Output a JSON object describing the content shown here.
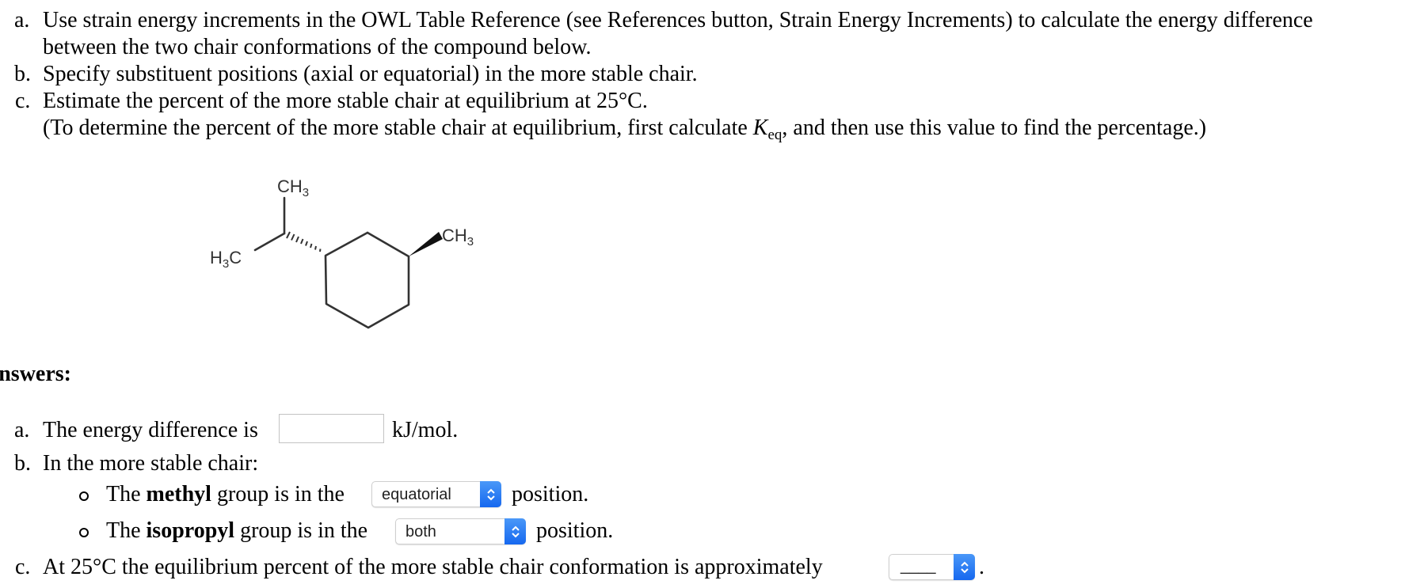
{
  "question": {
    "items": [
      {
        "marker": "a.",
        "lines": [
          "Use strain energy increments in the OWL Table Reference (see References button, Strain Energy Increments) to calculate the energy difference",
          "between the two chair conformations of the compound below."
        ]
      },
      {
        "marker": "b.",
        "lines": [
          "Specify substituent positions (axial or equatorial) in the more stable chair."
        ]
      },
      {
        "marker": "c.",
        "lines": [
          "Estimate the percent of the more stable chair at equilibrium at 25°C."
        ]
      }
    ],
    "note_prefix": "(To determine the percent of the more stable chair at equilibrium, first calculate ",
    "note_k": "K",
    "note_k_sub": "eq",
    "note_suffix": ", and then use this value to find the percentage.)"
  },
  "molecule": {
    "name": "isopropyl-methylcyclohexane structure",
    "labels": {
      "isopropyl_top_methyl": "CH3",
      "isopropyl_left_methyl": "H3C",
      "ring_methyl": "CH3"
    }
  },
  "answers": {
    "heading": "Answers:",
    "a": {
      "marker": "a.",
      "prefix": "The energy difference is",
      "input_value": "",
      "unit": "kJ/mol."
    },
    "b": {
      "marker": "b.",
      "label": "In the more stable chair:",
      "rows": [
        {
          "prefix": "The ",
          "bold": "methyl",
          "middle": " group is in the",
          "selected": "equatorial",
          "suffix": "position."
        },
        {
          "prefix": "The ",
          "bold": "isopropyl",
          "middle": " group is in the",
          "selected": "both",
          "suffix": "position."
        }
      ]
    },
    "c": {
      "marker": "c.",
      "prefix": "At 25°C the equilibrium percent of the more stable chair conformation is approximately",
      "selected": "____",
      "suffix": "."
    }
  },
  "colors": {
    "select_accent": "#1f73f0",
    "input_border": "#c3c3c3"
  }
}
